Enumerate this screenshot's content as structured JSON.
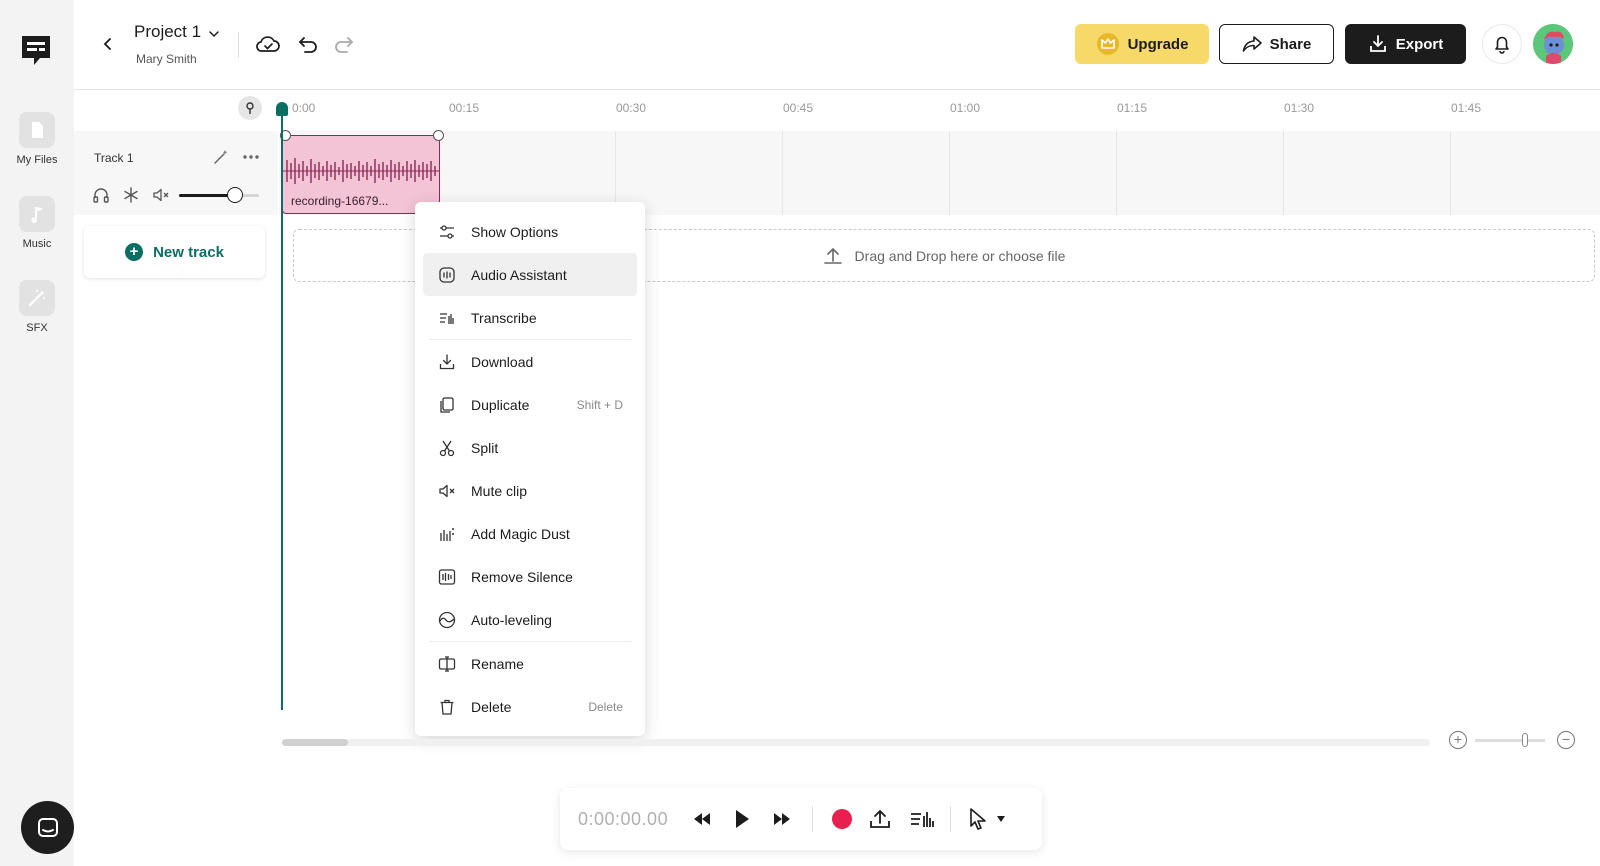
{
  "sidebar": {
    "items": [
      {
        "label": "My Files"
      },
      {
        "label": "Music"
      },
      {
        "label": "SFX"
      }
    ]
  },
  "header": {
    "project_title": "Project 1",
    "owner": "Mary Smith",
    "upgrade_label": "Upgrade",
    "share_label": "Share",
    "export_label": "Export"
  },
  "ruler": {
    "ticks": [
      "0:00",
      "00:15",
      "00:30",
      "00:45",
      "01:00",
      "01:15",
      "01:30",
      "01:45"
    ]
  },
  "track": {
    "name": "Track 1",
    "volume_level": 0.7,
    "clip_name": "recording-16679..."
  },
  "new_track_label": "New track",
  "dropzone_text": "Drag and Drop here or choose file",
  "context_menu": {
    "items": [
      {
        "label": "Show Options",
        "icon": "sliders-icon",
        "shortcut": ""
      },
      {
        "label": "Audio Assistant",
        "icon": "assistant-icon",
        "shortcut": ""
      },
      {
        "label": "Transcribe",
        "icon": "transcribe-icon",
        "shortcut": ""
      },
      {
        "label": "Download",
        "icon": "download-icon",
        "shortcut": ""
      },
      {
        "label": "Duplicate",
        "icon": "duplicate-icon",
        "shortcut": "Shift + D"
      },
      {
        "label": "Split",
        "icon": "scissors-icon",
        "shortcut": ""
      },
      {
        "label": "Mute clip",
        "icon": "mute-icon",
        "shortcut": ""
      },
      {
        "label": "Add Magic Dust",
        "icon": "magic-dust-icon",
        "shortcut": ""
      },
      {
        "label": "Remove Silence",
        "icon": "remove-silence-icon",
        "shortcut": ""
      },
      {
        "label": "Auto-leveling",
        "icon": "auto-leveling-icon",
        "shortcut": ""
      },
      {
        "label": "Rename",
        "icon": "rename-icon",
        "shortcut": ""
      },
      {
        "label": "Delete",
        "icon": "trash-icon",
        "shortcut": "Delete"
      }
    ]
  },
  "transport": {
    "time": "0:00:00.00"
  },
  "zoom": {
    "level": 0.72
  },
  "colors": {
    "accent": "#0b6e65",
    "upgrade": "#f7d96a",
    "clip_bg": "#f2c4d6",
    "clip_wave": "#8a2a55",
    "record": "#e8204f"
  }
}
